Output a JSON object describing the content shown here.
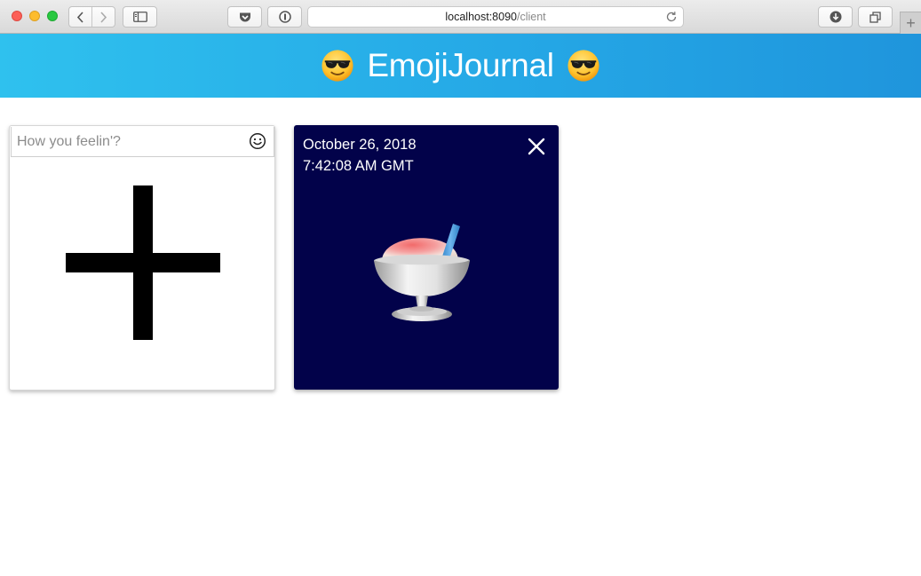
{
  "browser": {
    "url_host": "localhost:8090",
    "url_path": "/client",
    "new_tab_label": "+"
  },
  "header": {
    "title": "EmojiJournal",
    "left_emoji": "smiling-face-with-sunglasses",
    "right_emoji": "smiling-face-with-sunglasses",
    "gradient_start": "#2fc1ee",
    "gradient_end": "#1f95dc"
  },
  "new_entry": {
    "placeholder": "How you feelin'?",
    "value": "",
    "emoji_picker_icon": "smiley-icon",
    "add_icon": "plus-icon"
  },
  "entries": [
    {
      "date": "October 26, 2018",
      "time": "7:42:08 AM GMT",
      "emoji": "shaved-ice",
      "background": "#02024a",
      "close_icon": "close-icon"
    }
  ]
}
